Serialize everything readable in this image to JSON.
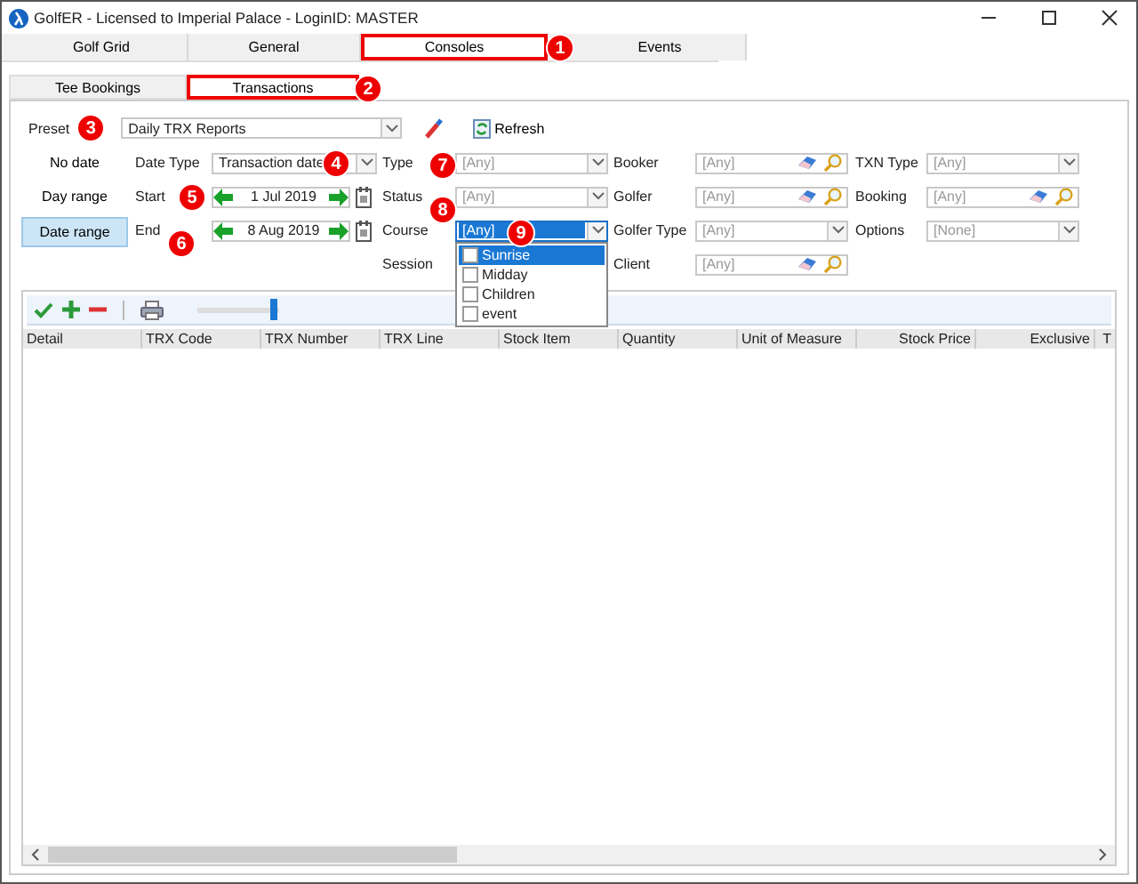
{
  "window": {
    "title": "GolfER - Licensed to Imperial Palace - LoginID: MASTER"
  },
  "main_tabs": [
    {
      "label": "Golf Grid",
      "selected": false
    },
    {
      "label": "General",
      "selected": false
    },
    {
      "label": "Consoles",
      "selected": true,
      "callout": "1"
    },
    {
      "label": "Events",
      "selected": false
    }
  ],
  "sub_tabs": [
    {
      "label": "Tee Bookings",
      "selected": false
    },
    {
      "label": "Transactions",
      "selected": true,
      "callout": "2"
    }
  ],
  "preset": {
    "label": "Preset",
    "callout": "3",
    "value": "Daily TRX Reports"
  },
  "refresh_button": {
    "label": "Refresh"
  },
  "date_modes": [
    {
      "label": "No date",
      "selected": false
    },
    {
      "label": "Day range",
      "selected": false
    },
    {
      "label": "Date range",
      "selected": true
    }
  ],
  "field_columns": [
    [
      {
        "label": "Date Type",
        "kind": "combo",
        "value": "Transaction date",
        "callout": "4"
      },
      {
        "label": "Start",
        "kind": "date",
        "value": "1 Jul 2019",
        "callout": "5"
      },
      {
        "label": "End",
        "kind": "date",
        "value": "8 Aug 2019",
        "callout": "6"
      }
    ],
    [
      {
        "label": "Type",
        "kind": "combo",
        "placeholder": "[Any]",
        "callout": "7"
      },
      {
        "label": "Status",
        "kind": "combo",
        "placeholder": "[Any]",
        "callout": "8"
      },
      {
        "label": "Course",
        "kind": "combo",
        "value": "[Any]",
        "callout": "9",
        "expanded": true,
        "options": [
          {
            "label": "Sunrise",
            "selected": true,
            "checked": false
          },
          {
            "label": "Midday",
            "selected": false,
            "checked": false
          },
          {
            "label": "Children",
            "selected": false,
            "checked": false
          },
          {
            "label": "event",
            "selected": false,
            "checked": false
          }
        ]
      },
      {
        "label": "Session",
        "kind": "label"
      }
    ],
    [
      {
        "label": "Booker",
        "kind": "lookup",
        "placeholder": "[Any]"
      },
      {
        "label": "Golfer",
        "kind": "lookup",
        "placeholder": "[Any]"
      },
      {
        "label": "Golfer Type",
        "kind": "combo",
        "placeholder": "[Any]"
      },
      {
        "label": "Client",
        "kind": "lookup",
        "placeholder": "[Any]"
      }
    ],
    [
      {
        "label": "TXN Type",
        "kind": "combo",
        "placeholder": "[Any]"
      },
      {
        "label": "Booking",
        "kind": "lookup",
        "placeholder": "[Any]"
      },
      {
        "label": "Options",
        "kind": "combo",
        "placeholder": "[None]"
      }
    ]
  ],
  "toolbar": {
    "level": 0.95
  },
  "grid": {
    "columns": [
      {
        "label": "Detail",
        "kind": "text"
      },
      {
        "label": "TRX Code",
        "kind": "text"
      },
      {
        "label": "TRX Number",
        "kind": "text"
      },
      {
        "label": "TRX Line",
        "kind": "text"
      },
      {
        "label": "Stock Item",
        "kind": "text"
      },
      {
        "label": "Quantity",
        "kind": "text"
      },
      {
        "label": "Unit of Measure",
        "kind": "text"
      },
      {
        "label": "Stock Price",
        "kind": "numeric"
      },
      {
        "label": "Exclusive",
        "kind": "numeric"
      },
      {
        "label": "T",
        "kind": "numeric"
      }
    ]
  }
}
